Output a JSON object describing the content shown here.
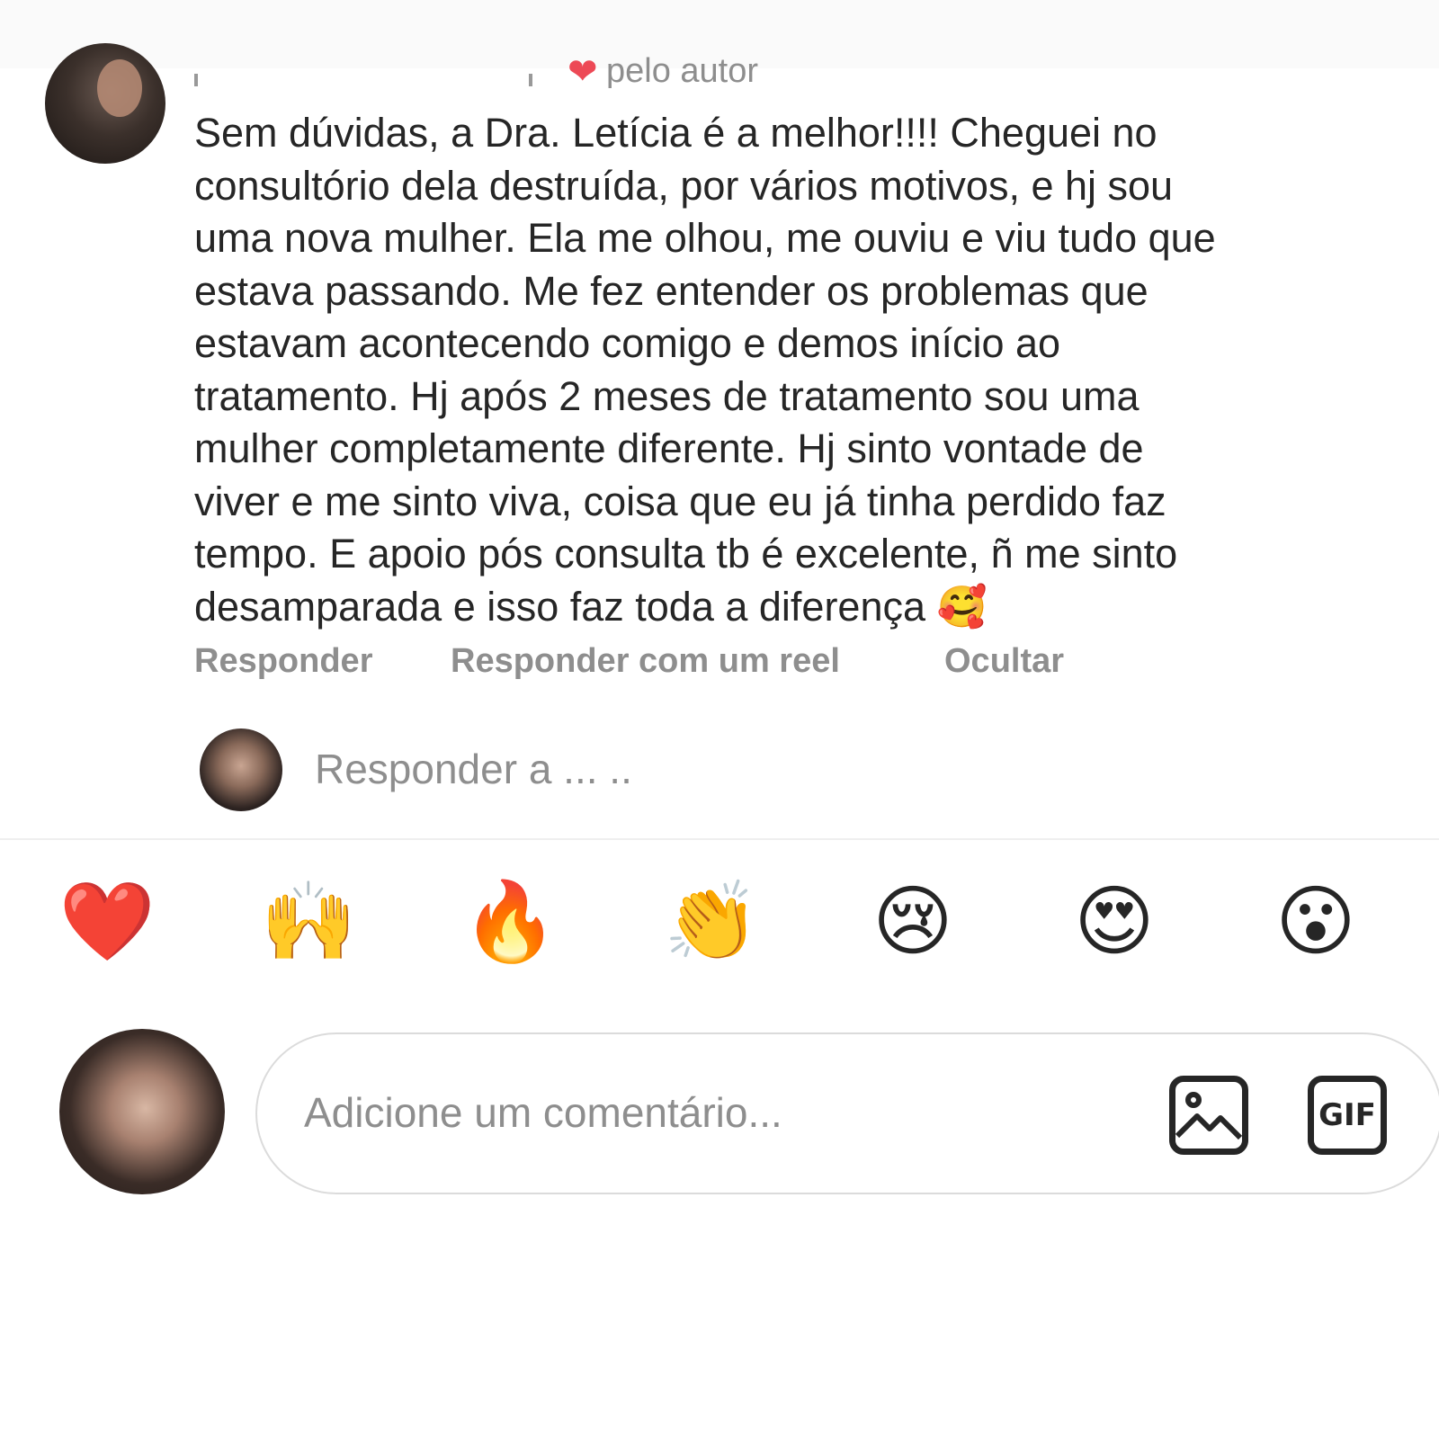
{
  "comment": {
    "liked_by_author": "pelo autor",
    "text": "Sem dúvidas,  a Dra. Letícia é a melhor!!!! Cheguei no\nconsultório dela destruída, por vários motivos,  e hj sou\numa nova mulher.  Ela me olhou, me ouviu e viu tudo que\nestava passando. Me fez entender os problemas que\nestavam acontecendo comigo e demos início ao\ntratamento.  Hj após 2 meses de tratamento sou uma\nmulher completamente diferente.  Hj sinto vontade de\nviver e me sinto viva, coisa que eu já tinha perdido faz\ntempo. E apoio pós consulta tb é excelente,  ñ me sinto\ndesamparada e isso faz toda a diferença 🥰",
    "actions": {
      "reply": "Responder",
      "reply_reel": "Responder com um reel",
      "hide": "Ocultar"
    }
  },
  "reply_prompt": "Responder a ... ..",
  "quick_reactions": [
    "❤️",
    "🙌",
    "🔥",
    "👏",
    "😢",
    "😍",
    "😮"
  ],
  "composer": {
    "placeholder": "Adicione um comentário...",
    "gif_label": "GIF"
  },
  "colors": {
    "text": "#262626",
    "muted": "#8e8e8e",
    "heart": "#ed4956",
    "border": "#dbdbdb"
  }
}
